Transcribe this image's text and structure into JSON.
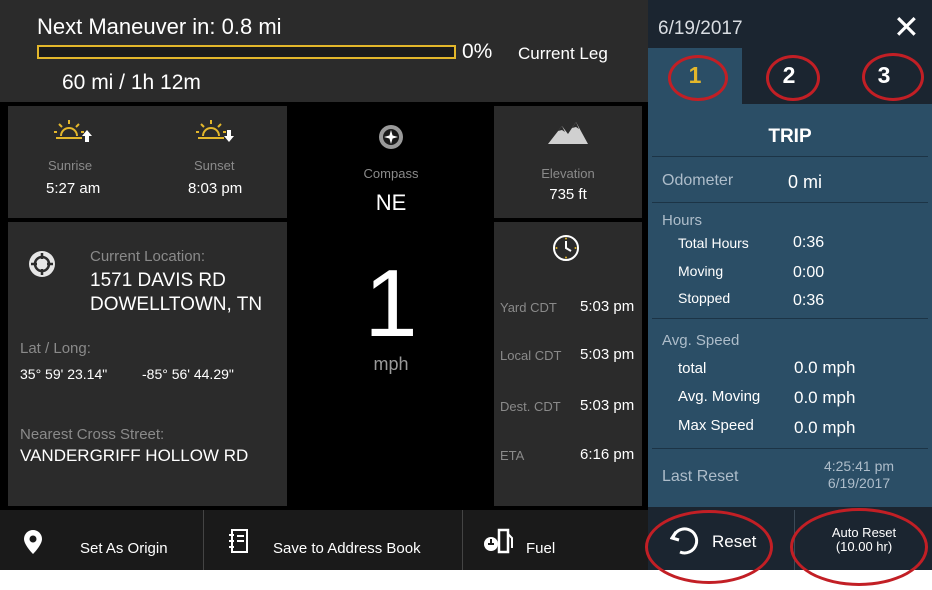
{
  "top": {
    "maneuver_title": "Next Maneuver in: 0.8 mi",
    "progress_pct_text": "0%",
    "progress_fraction": 0.0,
    "current_leg": "Current Leg",
    "distance_time": "60 mi / 1h 12m"
  },
  "sun": {
    "sunrise_label": "Sunrise",
    "sunrise_value": "5:27 am",
    "sunset_label": "Sunset",
    "sunset_value": "8:03 pm"
  },
  "compass": {
    "label": "Compass",
    "value": "NE"
  },
  "speed": {
    "value": "1",
    "unit": "mph"
  },
  "elevation": {
    "label": "Elevation",
    "value": "735 ft"
  },
  "location": {
    "current_label": "Current Location:",
    "address_line1": "1571 DAVIS RD",
    "address_line2": "DOWELLTOWN, TN",
    "latlong_label": "Lat / Long:",
    "lat": "35° 59' 23.14\"",
    "long": "-85° 56' 44.29\"",
    "cross_label": "Nearest Cross Street:",
    "cross_value": "VANDERGRIFF HOLLOW RD"
  },
  "times": {
    "rows": [
      {
        "label": "Yard CDT",
        "value": "5:03 pm"
      },
      {
        "label": "Local CDT",
        "value": "5:03 pm"
      },
      {
        "label": "Dest. CDT",
        "value": "5:03 pm"
      },
      {
        "label": "ETA",
        "value": "6:16 pm"
      }
    ]
  },
  "bottom": {
    "set_origin": "Set As Origin",
    "save_address": "Save to Address Book",
    "fuel": "Fuel"
  },
  "right": {
    "date": "6/19/2017",
    "close_glyph": "✕",
    "tabs": [
      {
        "label": "1"
      },
      {
        "label": "2"
      },
      {
        "label": "3"
      }
    ],
    "trip_title": "TRIP",
    "odometer_label": "Odometer",
    "odometer_value": "0 mi",
    "hours_label": "Hours",
    "total_hours_label": "Total Hours",
    "total_hours_value": "0:36",
    "moving_label": "Moving",
    "moving_value": "0:00",
    "stopped_label": "Stopped",
    "stopped_value": "0:36",
    "avg_speed_label": "Avg. Speed",
    "total_label": "total",
    "total_value": "0.0 mph",
    "avg_moving_label": "Avg. Moving",
    "avg_moving_value": "0.0 mph",
    "max_speed_label": "Max Speed",
    "max_speed_value": "0.0 mph",
    "last_reset_label": "Last Reset",
    "last_reset_time": "4:25:41 pm",
    "last_reset_date": "6/19/2017",
    "reset_label": "Reset",
    "auto_reset_line1": "Auto Reset",
    "auto_reset_line2": "(10.00 hr)"
  },
  "colors": {
    "accent_yellow": "#e3b72b",
    "panel_gray": "#2b2b2b",
    "trip_blue": "#2b4e66",
    "annotation_red": "#c21f25"
  },
  "icons": {
    "sunrise": "sunrise-icon",
    "sunset": "sunset-icon",
    "compass": "compass-icon",
    "elevation": "mountain-icon",
    "location": "crosshair-icon",
    "clock": "clock-icon",
    "origin": "map-pin-icon",
    "address_book": "address-book-icon",
    "fuel": "fuel-pump-icon",
    "reset": "undo-arrow-icon",
    "close": "close-icon"
  }
}
